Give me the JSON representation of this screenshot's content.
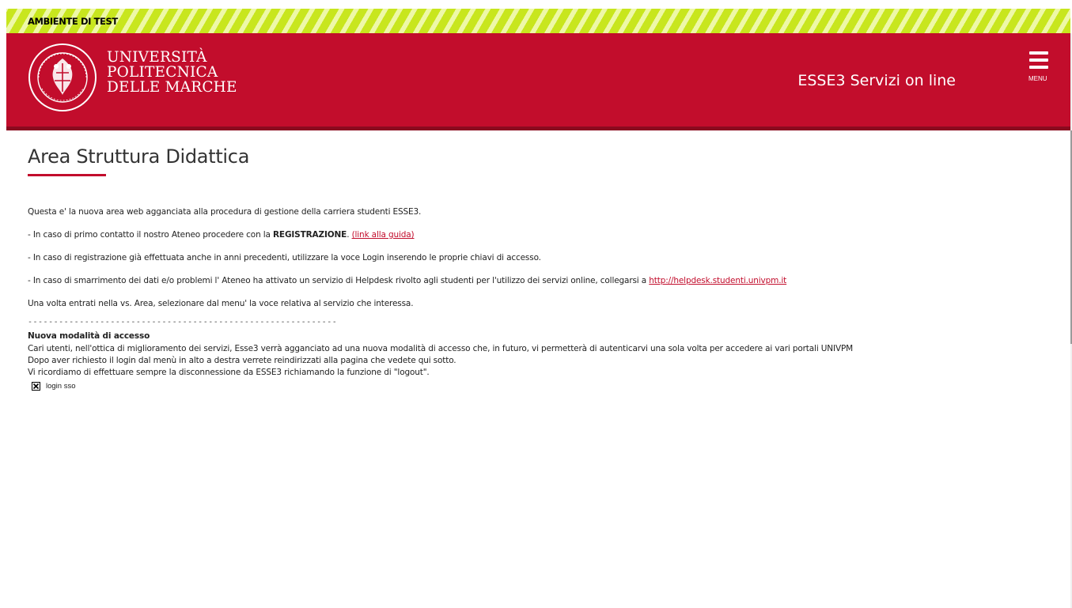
{
  "banner": {
    "text": "AMBIENTE DI TEST",
    "color": "#c8e61e"
  },
  "header": {
    "brand_color": "#c20d2c",
    "logo_lines": [
      "UNIVERSITÀ",
      "POLITECNICA",
      "DELLE MARCHE"
    ],
    "service_title": "ESSE3 Servizi on line",
    "menu_label": "MENU",
    "menu_icon": "hamburger-icon"
  },
  "main": {
    "title": "Area Struttura Didattica",
    "intro": "Questa e' la nuova area web agganciata alla procedura di gestione della carriera studenti ESSE3.",
    "line1_prefix": "- In caso di primo contatto il nostro Ateneo procedere con la ",
    "line1_bold": "REGISTRAZIONE",
    "line1_sep": ". ",
    "line1_link": "(link alla guida)",
    "line2": "- In caso di registrazione già effettuata anche in anni precedenti, utilizzare la voce Login inserendo le proprie chiavi di accesso.",
    "line3_prefix": "- In caso di smarrimento dei dati e/o problemi l' Ateneo ha attivato un servizio di Helpdesk rivolto agli studenti per l'utilizzo dei servizi online, collegarsi a ",
    "line3_link": "http://helpdesk.studenti.univpm.it",
    "line4": "Una volta entrati nella vs. Area, selezionare dal menu' la voce relativa al servizio che interessa.",
    "separator": "------------------------------------------------------------",
    "access_heading": "Nuova modalità di accesso",
    "access_lines": [
      "Cari utenti, nell'ottica di miglioramento dei servizi, Esse3 verrà agganciato ad una nuova modalità di accesso che, in futuro, vi permetterà di autenticarvi una sola volta per accedere ai vari portali UNIVPM",
      "Dopo aver richiesto il login dal menù in alto a destra verrete reindirizzati alla pagina che vedete qui sotto.",
      "Vi ricordiamo di effettuare sempre la disconnessione da ESSE3 richiamando la funzione di \"logout\"."
    ],
    "sso_label": "login sso",
    "sso_icon": "broken-image-icon"
  }
}
